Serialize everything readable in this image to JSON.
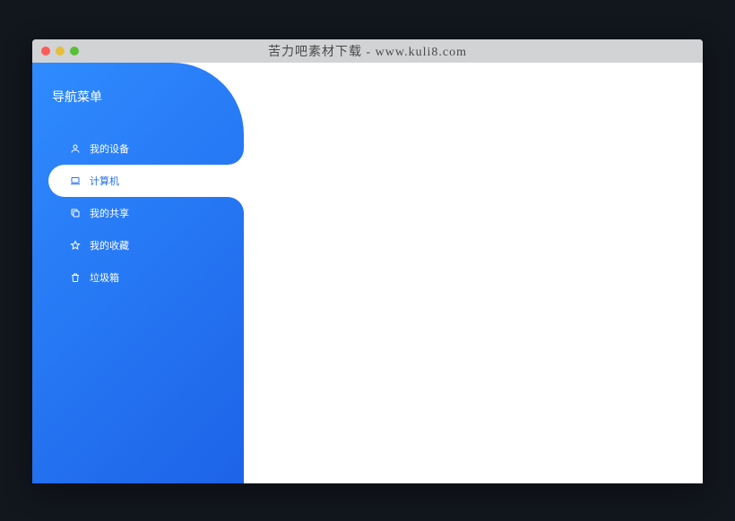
{
  "window": {
    "title": "苦力吧素材下载 - www.kuli8.com"
  },
  "sidebar": {
    "title": "导航菜单",
    "items": [
      {
        "label": "我的设备",
        "icon": "user-icon",
        "active": false
      },
      {
        "label": "计算机",
        "icon": "laptop-icon",
        "active": true
      },
      {
        "label": "我的共享",
        "icon": "copy-icon",
        "active": false
      },
      {
        "label": "我的收藏",
        "icon": "star-icon",
        "active": false
      },
      {
        "label": "垃圾箱",
        "icon": "trash-icon",
        "active": false
      }
    ]
  }
}
